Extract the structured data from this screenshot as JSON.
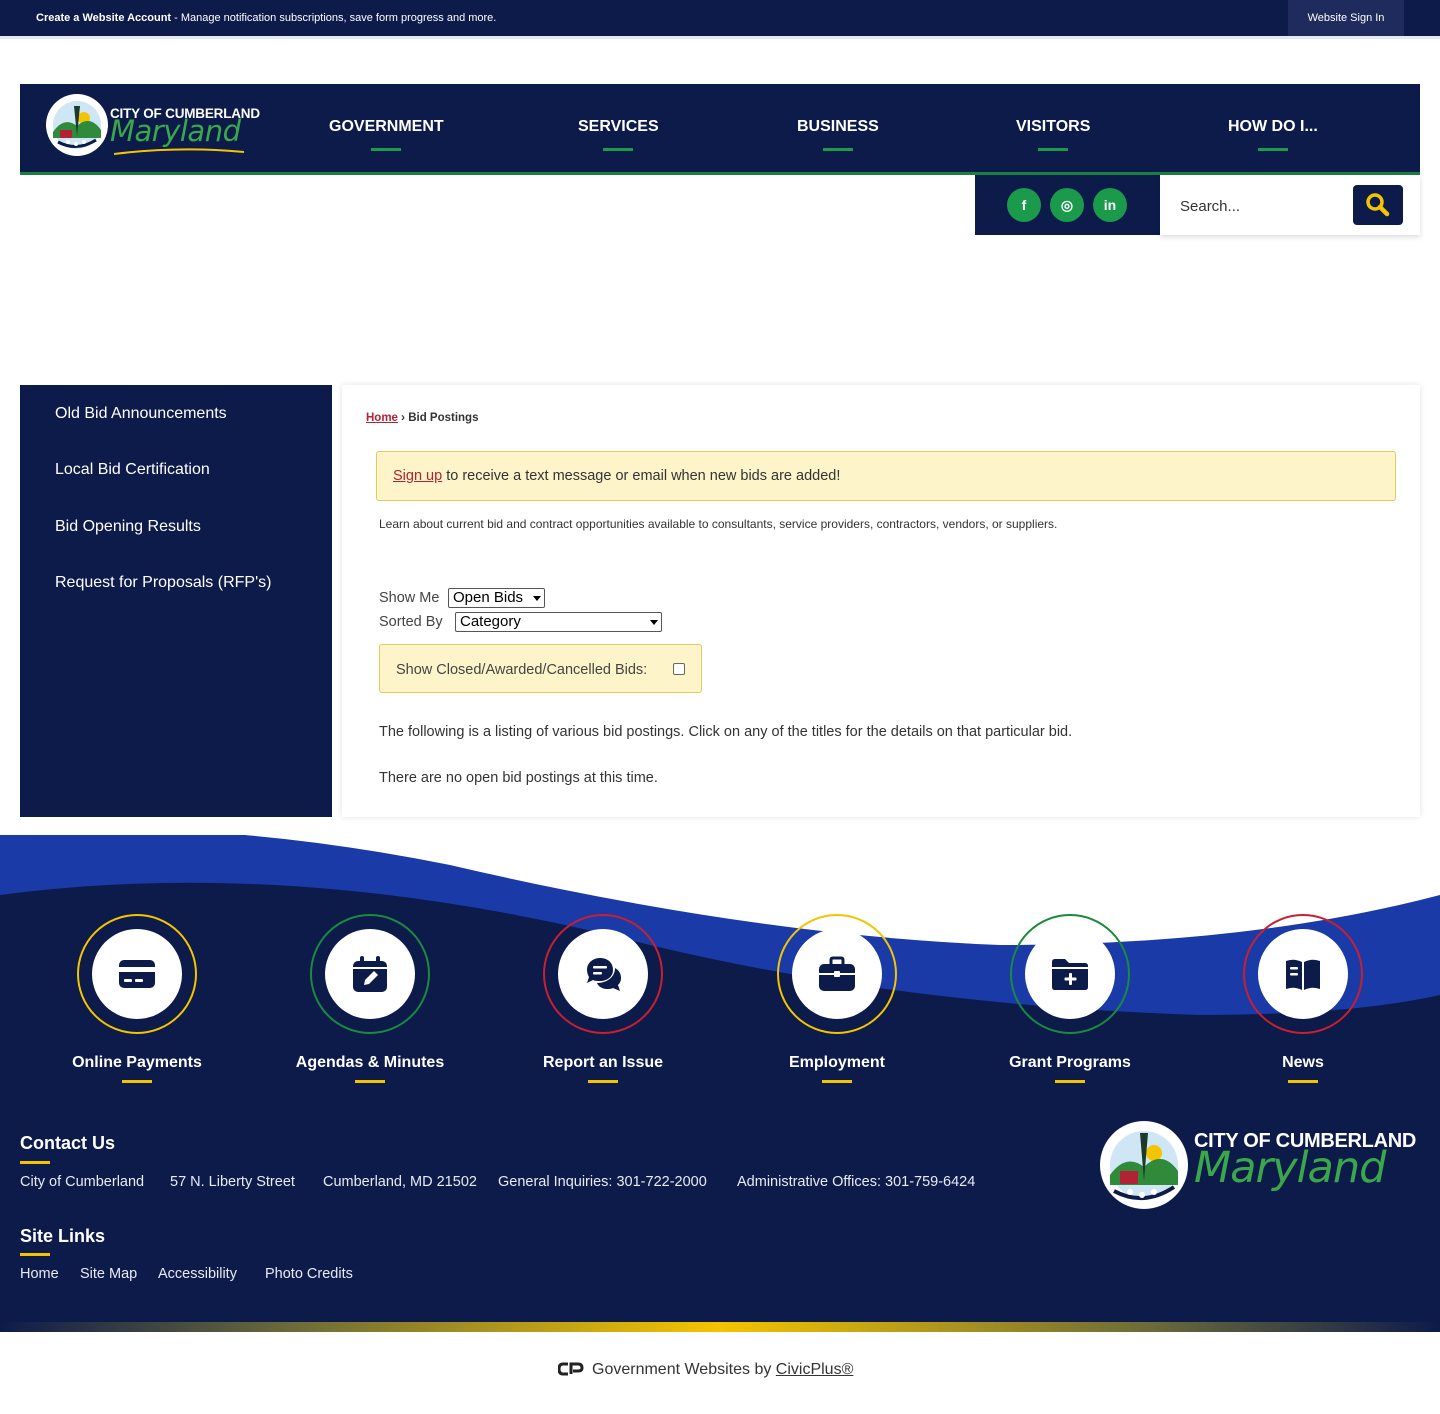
{
  "topbar": {
    "create_account": "Create a Website Account",
    "create_desc": " - Manage notification subscriptions, save form progress and more.",
    "sign_in": "Website Sign In"
  },
  "logo": {
    "line1": "CITY OF CUMBERLAND",
    "line2": "Maryland"
  },
  "nav": [
    {
      "label": "GOVERNMENT"
    },
    {
      "label": "SERVICES"
    },
    {
      "label": "BUSINESS"
    },
    {
      "label": "VISITORS"
    },
    {
      "label": "HOW DO I..."
    }
  ],
  "social": [
    {
      "icon": "facebook-icon",
      "glyph": "f"
    },
    {
      "icon": "instagram-icon",
      "glyph": "◎"
    },
    {
      "icon": "linkedin-icon",
      "glyph": "in"
    }
  ],
  "search": {
    "placeholder": "Search..."
  },
  "sidebar": {
    "items": [
      {
        "label": "Old Bid Announcements"
      },
      {
        "label": "Local Bid Certification"
      },
      {
        "label": "Bid Opening Results"
      },
      {
        "label": "Request for Proposals (RFP's)"
      }
    ]
  },
  "breadcrumb": {
    "home": "Home",
    "sep": " › ",
    "current": "Bid Postings"
  },
  "alert": {
    "link": "Sign up",
    "text": " to receive a text message or email when new bids are added!"
  },
  "intro": "Learn about current bid and contract opportunities available to consultants, service providers, contractors, vendors, or suppliers.",
  "filters": {
    "show_me_label": "Show Me",
    "show_me_value": "Open Bids",
    "sorted_by_label": "Sorted By",
    "sorted_by_value": "Category",
    "closed_label": "Show Closed/Awarded/Cancelled Bids:"
  },
  "listing_text": "The following is a listing of various bid postings. Click on any of the titles for the details on that particular bid.",
  "empty_text": "There are no open bid postings at this time.",
  "quick_links": [
    {
      "label": "Online Payments",
      "icon": "credit-card-icon",
      "ring": "#f5c400"
    },
    {
      "label": "Agendas & Minutes",
      "icon": "calendar-icon",
      "ring": "#1a8a3e"
    },
    {
      "label": "Report an Issue",
      "icon": "chat-bubbles-icon",
      "ring": "#c8202f"
    },
    {
      "label": "Employment",
      "icon": "briefcase-icon",
      "ring": "#f5c400"
    },
    {
      "label": "Grant Programs",
      "icon": "folder-plus-icon",
      "ring": "#1a8a3e"
    },
    {
      "label": "News",
      "icon": "book-icon",
      "ring": "#c8202f"
    }
  ],
  "contact": {
    "heading": "Contact Us",
    "items": [
      "City of Cumberland",
      "57 N. Liberty Street",
      "Cumberland, MD 21502",
      "General Inquiries: 301-722-2000",
      "Administrative Offices: 301-759-6424"
    ]
  },
  "site_links": {
    "heading": "Site Links",
    "items": [
      "Home",
      "Site Map",
      "Accessibility",
      "Photo Credits"
    ]
  },
  "civicplus": {
    "prefix": "Government Websites by ",
    "link": "CivicPlus®"
  },
  "colors": {
    "navy": "#0d1b4b",
    "green": "#1a9a4a",
    "gold": "#f5c400",
    "red": "#c8202f",
    "alert_bg": "#fdf5c9"
  }
}
